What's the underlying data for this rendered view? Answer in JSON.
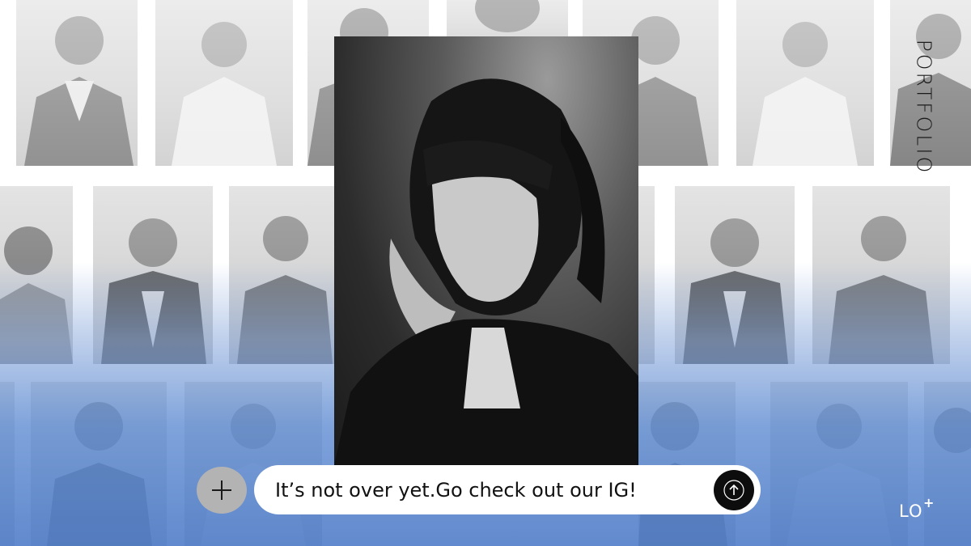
{
  "side_title": "PORTFOLIO",
  "chat": {
    "message": "It’s not over yet.Go check out our IG!"
  },
  "logo": {
    "letters": "LO",
    "superscript": "+"
  },
  "icons": {
    "plus": "plus-icon",
    "send": "arrow-up-icon"
  },
  "colors": {
    "accent_blue": "#5f8cd2",
    "send_button": "#0d0d0d",
    "plus_button": "#b3b3b3"
  }
}
